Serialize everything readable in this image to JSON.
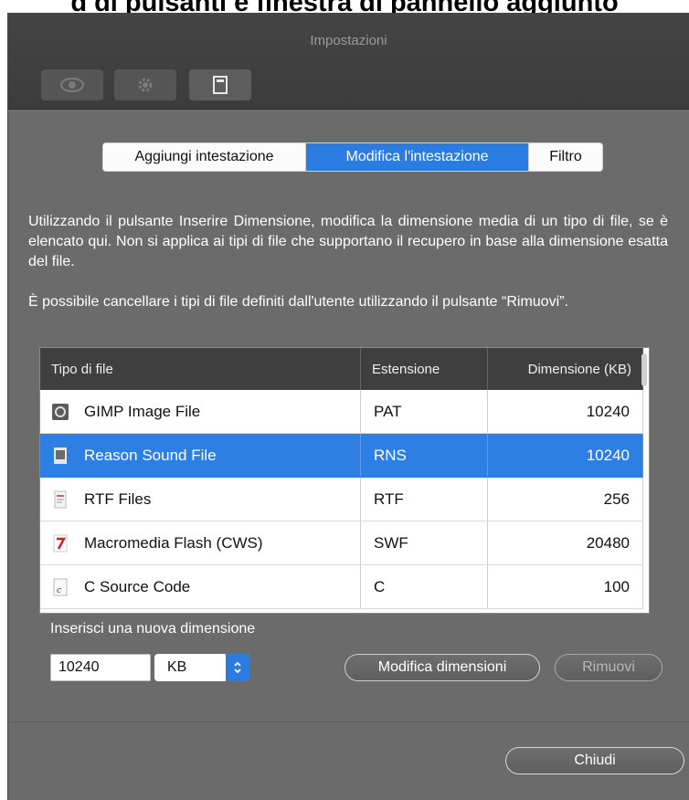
{
  "caption": "d di pulsanti e finestra di pannello aggiunto",
  "window": {
    "title": "Impostazioni",
    "toolbar": [
      {
        "icon": "eye-icon"
      },
      {
        "icon": "gear-icon"
      },
      {
        "icon": "document-icon"
      }
    ]
  },
  "tabs": [
    {
      "label": "Aggiungi intestazione",
      "active": false
    },
    {
      "label": "Modifica l'intestazione",
      "active": true
    },
    {
      "label": "Filtro",
      "active": false
    }
  ],
  "description": [
    "Utilizzando il pulsante Inserire Dimensione, modifica la dimensione media di un tipo di file, se è elencato qui. Non si applica ai tipi di file che supportano il recupero in base alla dimensione esatta del file.",
    "È possibile cancellare i tipi di file definiti dall'utente utilizzando il pulsante “Rimuovi”."
  ],
  "table": {
    "columns": [
      "Tipo di file",
      "Estensione",
      "Dimensione (KB)"
    ],
    "rows": [
      {
        "name": "GIMP Image File",
        "ext": "PAT",
        "size": "10240",
        "icon": "gimp-file-icon",
        "selected": false
      },
      {
        "name": "Reason Sound File",
        "ext": "RNS",
        "size": "10240",
        "icon": "sound-file-icon",
        "selected": true
      },
      {
        "name": "RTF Files",
        "ext": "RTF",
        "size": "256",
        "icon": "rtf-file-icon",
        "selected": false
      },
      {
        "name": "Macromedia Flash (CWS)",
        "ext": "SWF",
        "size": "20480",
        "icon": "flash-file-icon",
        "selected": false
      },
      {
        "name": "C Source Code",
        "ext": "C",
        "size": "100",
        "icon": "c-source-file-icon",
        "selected": false
      }
    ]
  },
  "form": {
    "label": "Inserisci una nuova dimensione",
    "size_value": "10240",
    "unit": "KB",
    "modify_label": "Modifica dimensioni",
    "remove_label": "Rimuovi"
  },
  "footer": {
    "close_label": "Chiudi"
  },
  "colors": {
    "accent": "#2b7ce0",
    "window_bg": "#6b6b6b",
    "titlebar_bg": "#3e3e3e"
  }
}
